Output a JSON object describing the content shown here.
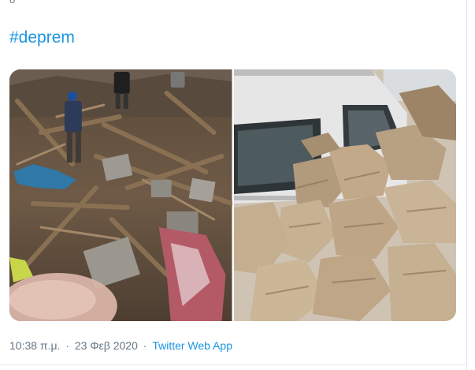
{
  "tweet": {
    "top_fragment": "ο",
    "hashtag": "#deprem",
    "time": "10:38 π.μ.",
    "separator_1": "·",
    "date": "23 Φεβ 2020",
    "separator_2": "·",
    "source": "Twitter Web App"
  },
  "colors": {
    "link": "#1b95e0",
    "meta_text": "#657786",
    "border": "#e1e8ed"
  },
  "media": [
    {
      "kind": "photo",
      "subject": "collapsed-building-rubble"
    },
    {
      "kind": "photo",
      "subject": "van-crushed-by-rocks"
    }
  ]
}
